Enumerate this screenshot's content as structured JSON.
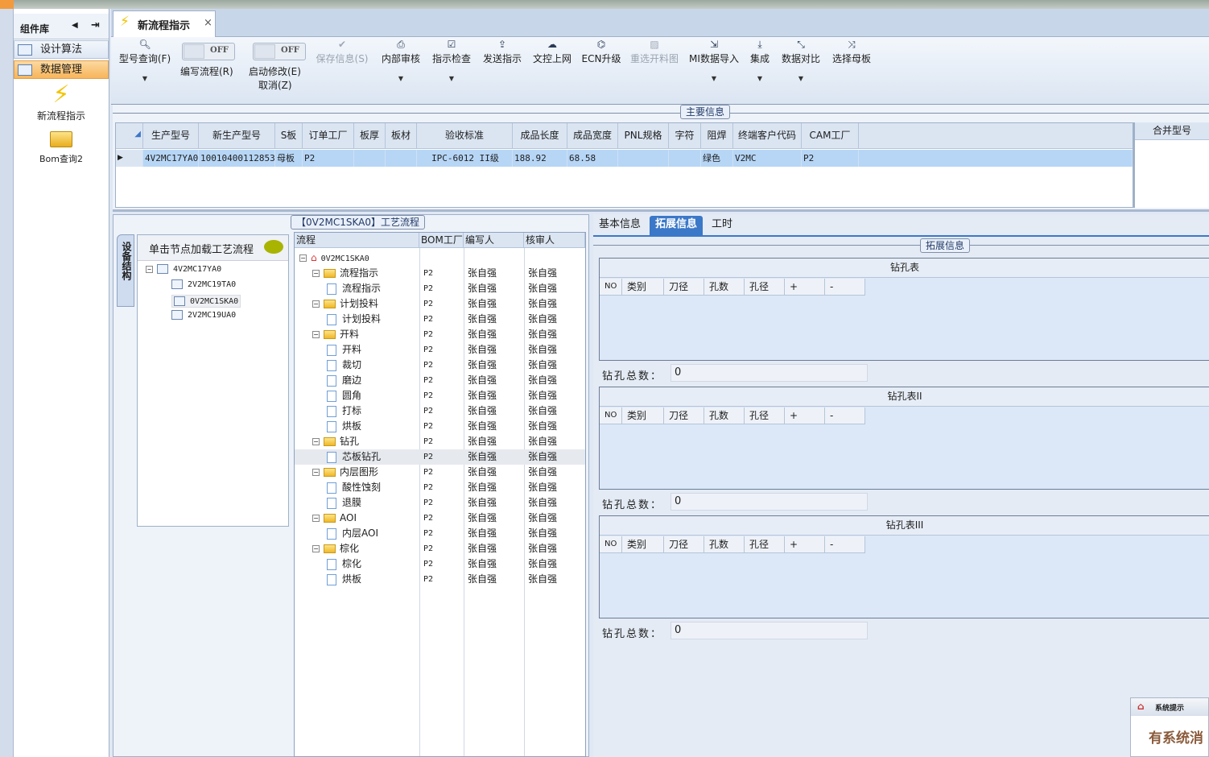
{
  "sidebar": {
    "title": "组件库",
    "items": [
      {
        "label": "设计算法"
      },
      {
        "label": "数据管理"
      }
    ],
    "launchers": [
      {
        "label": "新流程指示",
        "icon": "lightning-icon"
      },
      {
        "label": "Bom查询2",
        "icon": "folder-open-icon"
      }
    ]
  },
  "tab": {
    "label": "新流程指示",
    "close": "×"
  },
  "toolbar": {
    "search": {
      "label": "型号查询(F)"
    },
    "write_toggle": {
      "state": "OFF",
      "label": "编写流程(R)"
    },
    "modify_toggle": {
      "state": "OFF",
      "label": "启动修改(E)",
      "label2": "取消(Z)"
    },
    "buttons": [
      {
        "label": "保存信息(S)",
        "icon": "check-icon",
        "disabled": true,
        "dd": false
      },
      {
        "label": "内部审核",
        "icon": "print-icon",
        "dd": true
      },
      {
        "label": "指示检查",
        "icon": "checkbox-icon",
        "dd": true
      },
      {
        "label": "发送指示",
        "icon": "upload-icon",
        "dd": false
      },
      {
        "label": "文控上网",
        "icon": "cloud-upload-icon",
        "dd": false
      },
      {
        "label": "ECN升级",
        "icon": "binoculars-icon",
        "dd": false
      },
      {
        "label": "重选开料图",
        "icon": "image-icon",
        "disabled": true,
        "dd": false
      },
      {
        "label": "MI数据导入",
        "icon": "import-icon",
        "dd": true
      },
      {
        "label": "集成",
        "icon": "download-icon",
        "dd": true
      },
      {
        "label": "数据对比",
        "icon": "compress-icon",
        "dd": true
      },
      {
        "label": "选择母板",
        "icon": "shuffle-icon",
        "dd": false
      }
    ]
  },
  "main_info": {
    "legend": "主要信息",
    "columns": [
      "生产型号",
      "新生产型号",
      "S板",
      "订单工厂",
      "板厚",
      "板材",
      "验收标准",
      "成品长度",
      "成品宽度",
      "PNL规格",
      "字符",
      "阻焊",
      "终端客户代码",
      "CAM工厂"
    ],
    "rows": [
      [
        "4V2MC17YA0",
        "10010400112853",
        "母板",
        "P2",
        "",
        "",
        "IPC-6012 II级",
        "188.92",
        "68.58",
        "",
        "",
        "绿色",
        "V2MC",
        "P2"
      ]
    ],
    "merge_header": "合并型号"
  },
  "nav": {
    "vtab": "设备结构",
    "hint": "单击节点加载工艺流程",
    "tree": [
      {
        "label": "4V2MC17YA0",
        "level": 0
      },
      {
        "label": "2V2MC19TA0",
        "level": 1
      },
      {
        "label": "0V2MC1SKA0",
        "level": 1,
        "selected": true
      },
      {
        "label": "2V2MC19UA0",
        "level": 1
      }
    ]
  },
  "flow": {
    "legend": "【0V2MC1SKA0】工艺流程",
    "columns": [
      "流程",
      "BOM工厂",
      "编写人",
      "核审人"
    ],
    "root": "0V2MC1SKA0",
    "rows": [
      {
        "name": "流程指示",
        "type": "folder",
        "bom": "P2",
        "writer": "张自强",
        "reviewer": "张自强"
      },
      {
        "name": "流程指示",
        "type": "doc",
        "bom": "P2",
        "writer": "张自强",
        "reviewer": "张自强"
      },
      {
        "name": "计划投料",
        "type": "folder",
        "bom": "P2",
        "writer": "张自强",
        "reviewer": "张自强"
      },
      {
        "name": "计划投料",
        "type": "doc",
        "bom": "P2",
        "writer": "张自强",
        "reviewer": "张自强"
      },
      {
        "name": "开料",
        "type": "folder",
        "bom": "P2",
        "writer": "张自强",
        "reviewer": "张自强"
      },
      {
        "name": "开料",
        "type": "doc",
        "bom": "P2",
        "writer": "张自强",
        "reviewer": "张自强"
      },
      {
        "name": "裁切",
        "type": "doc",
        "bom": "P2",
        "writer": "张自强",
        "reviewer": "张自强"
      },
      {
        "name": "磨边",
        "type": "doc",
        "bom": "P2",
        "writer": "张自强",
        "reviewer": "张自强"
      },
      {
        "name": "圆角",
        "type": "doc",
        "bom": "P2",
        "writer": "张自强",
        "reviewer": "张自强"
      },
      {
        "name": "打标",
        "type": "doc",
        "bom": "P2",
        "writer": "张自强",
        "reviewer": "张自强"
      },
      {
        "name": "烘板",
        "type": "doc",
        "bom": "P2",
        "writer": "张自强",
        "reviewer": "张自强"
      },
      {
        "name": "钻孔",
        "type": "folder",
        "bom": "P2",
        "writer": "张自强",
        "reviewer": "张自强"
      },
      {
        "name": "芯板钻孔",
        "type": "doc",
        "bom": "P2",
        "writer": "张自强",
        "reviewer": "张自强",
        "selected": true
      },
      {
        "name": "内层图形",
        "type": "folder",
        "bom": "P2",
        "writer": "张自强",
        "reviewer": "张自强"
      },
      {
        "name": "酸性蚀刻",
        "type": "doc",
        "bom": "P2",
        "writer": "张自强",
        "reviewer": "张自强"
      },
      {
        "name": "退膜",
        "type": "doc",
        "bom": "P2",
        "writer": "张自强",
        "reviewer": "张自强"
      },
      {
        "name": "AOI",
        "type": "folder",
        "bom": "P2",
        "writer": "张自强",
        "reviewer": "张自强"
      },
      {
        "name": "内层AOI",
        "type": "doc",
        "bom": "P2",
        "writer": "张自强",
        "reviewer": "张自强"
      },
      {
        "name": "棕化",
        "type": "folder",
        "bom": "P2",
        "writer": "张自强",
        "reviewer": "张自强"
      },
      {
        "name": "棕化",
        "type": "doc",
        "bom": "P2",
        "writer": "张自强",
        "reviewer": "张自强"
      },
      {
        "name": "烘板",
        "type": "doc",
        "bom": "P2",
        "writer": "张自强",
        "reviewer": "张自强"
      }
    ]
  },
  "right": {
    "tabs": [
      {
        "label": "基本信息"
      },
      {
        "label": "拓展信息",
        "active": true
      },
      {
        "label": "工时"
      }
    ],
    "legend": "拓展信息",
    "drill_columns": [
      "NO",
      "类别",
      "刀径",
      "孔数",
      "孔径",
      "+",
      "-"
    ],
    "tables": [
      {
        "title": "钻孔表",
        "total_label": "钻孔总数：",
        "total": "0"
      },
      {
        "title": "钻孔表II",
        "total_label": "钻孔总数：",
        "total": "0"
      },
      {
        "title": "钻孔表III",
        "total_label": "钻孔总数：",
        "total": "0"
      }
    ]
  },
  "popup": {
    "title": "系统提示",
    "body": "有系统消"
  },
  "colors": {
    "accent": "#3b78c8",
    "selection": "#b7d6f6",
    "active_sidebar": "#f7b55a"
  }
}
